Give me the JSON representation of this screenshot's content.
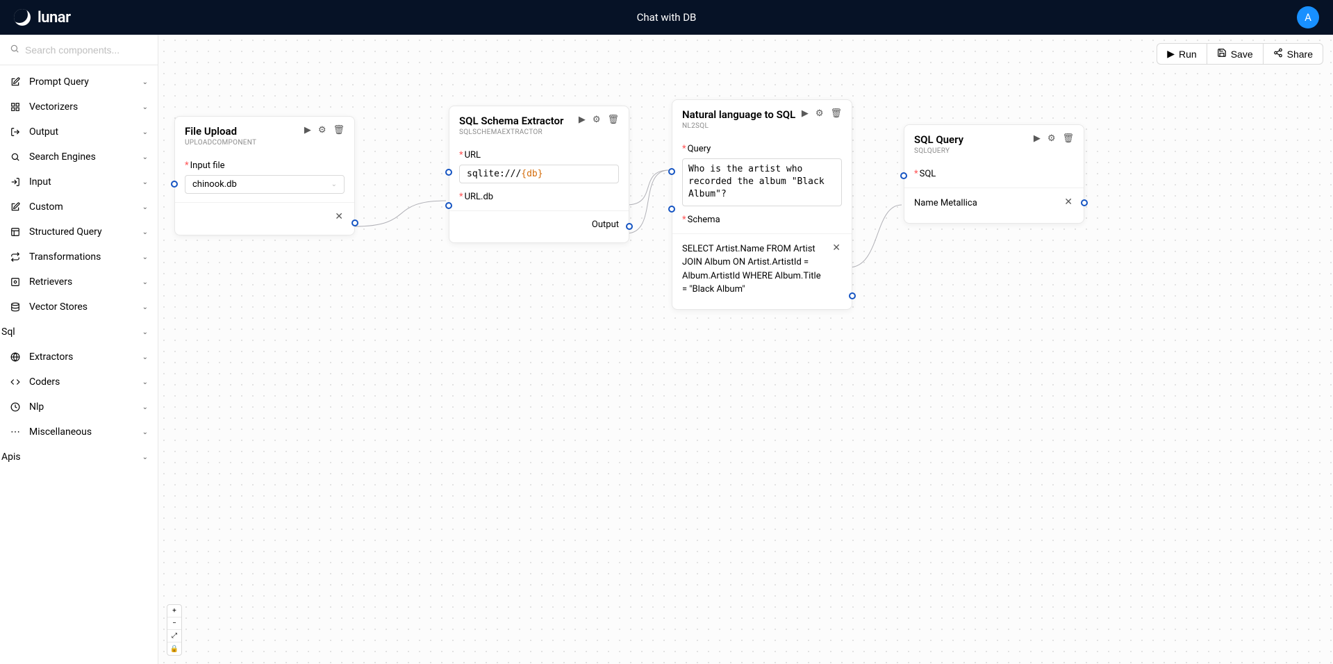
{
  "header": {
    "brand": "lunar",
    "title": "Chat with DB",
    "avatar_initial": "A"
  },
  "toolbar": {
    "run": "Run",
    "save": "Save",
    "share": "Share"
  },
  "search": {
    "placeholder": "Search components..."
  },
  "sidebar": {
    "items": [
      {
        "label": "Prompt Query",
        "icon": "edit"
      },
      {
        "label": "Vectorizers",
        "icon": "grid"
      },
      {
        "label": "Output",
        "icon": "output"
      },
      {
        "label": "Search Engines",
        "icon": "search"
      },
      {
        "label": "Input",
        "icon": "input"
      },
      {
        "label": "Custom",
        "icon": "edit"
      },
      {
        "label": "Structured Query",
        "icon": "struct"
      },
      {
        "label": "Transformations",
        "icon": "transform"
      },
      {
        "label": "Retrievers",
        "icon": "retrieve"
      },
      {
        "label": "Vector Stores",
        "icon": "store"
      },
      {
        "label": "Sql",
        "icon": ""
      },
      {
        "label": "Extractors",
        "icon": "globe"
      },
      {
        "label": "Coders",
        "icon": "code"
      },
      {
        "label": "Nlp",
        "icon": "nlp"
      },
      {
        "label": "Miscellaneous",
        "icon": "dots"
      },
      {
        "label": "Apis",
        "icon": ""
      }
    ]
  },
  "nodes": {
    "upload": {
      "title": "File Upload",
      "subtitle": "UPLOADCOMPONENT",
      "input_file_label": "Input file",
      "input_file_value": "chinook.db"
    },
    "schema": {
      "title": "SQL Schema Extractor",
      "subtitle": "SQLSCHEMAEXTRACTOR",
      "url_label": "URL",
      "url_value_prefix": "sqlite:///",
      "url_value_tpl": "{db}",
      "url_db_label": "URL.db",
      "output_label": "Output"
    },
    "nl2sql": {
      "title": "Natural language to SQL",
      "subtitle": "NL2SQL",
      "query_label": "Query",
      "query_value": "Who is the artist who recorded the album \"Black Album\"?",
      "schema_label": "Schema",
      "result": "SELECT Artist.Name FROM Artist JOIN Album ON Artist.ArtistId = Album.ArtistId WHERE Album.Title = \"Black Album\""
    },
    "sqlquery": {
      "title": "SQL Query",
      "subtitle": "SQLQUERY",
      "sql_label": "SQL",
      "result": "Name Metallica"
    }
  }
}
